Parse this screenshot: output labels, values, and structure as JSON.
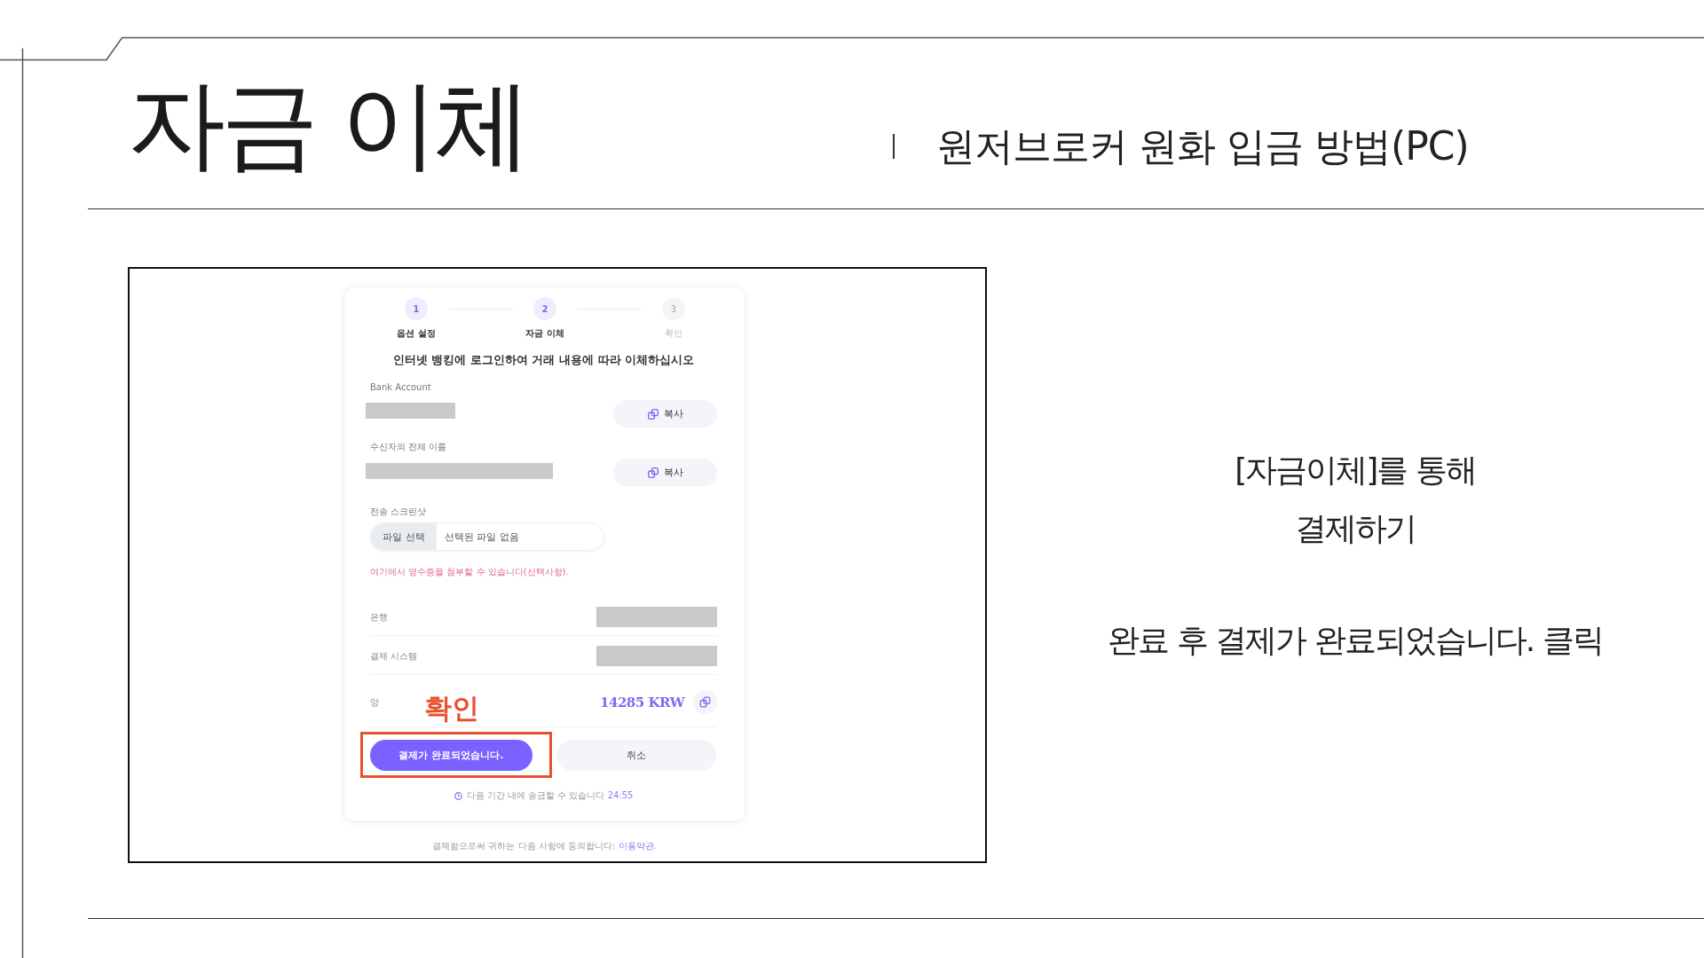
{
  "slide": {
    "title": "자금 이체",
    "subtitle": "원저브로커 원화 입금 방법(PC)"
  },
  "screenshot": {
    "steps": [
      {
        "number": "1",
        "label": "옵션 설정",
        "active": true
      },
      {
        "number": "2",
        "label": "자금 이체",
        "active": true
      },
      {
        "number": "3",
        "label": "확인",
        "active": false
      }
    ],
    "heading": "인터넷 뱅킹에 로그인하여 거래 내용에 따라 이체하십시오",
    "copy_fields": [
      {
        "label": "Bank Account",
        "button": "복사"
      },
      {
        "label": "수신자의 전체 이름",
        "button": "복사"
      }
    ],
    "upload": {
      "label": "전송 스크린샷",
      "button": "파일 선택",
      "value": "선택된 파일 없음",
      "note": "여기에서 영수증을 첨부할 수 있습니다(선택사항)."
    },
    "details": [
      {
        "kind": "redacted",
        "label": "은행"
      },
      {
        "kind": "redacted",
        "label": "결제 시스템"
      },
      {
        "kind": "amount",
        "label": "양",
        "value": "14285 KRW"
      }
    ],
    "annotation": {
      "text": "확인"
    },
    "buttons": [
      {
        "kind": "primary",
        "label": "결제가 완료되었습니다.",
        "highlighted": true
      },
      {
        "kind": "secondary",
        "label": "취소",
        "highlighted": false
      }
    ],
    "timer": {
      "text": "다음 기간 내에 송금할 수 있습니다",
      "time": "24:55"
    },
    "footer": {
      "text": "결제함으로써 귀하는 다음 사항에 동의합니다:",
      "link": "이용약관",
      "after": "."
    }
  },
  "notes": {
    "lines": [
      "[자금이체]를 통해",
      "결제하기"
    ],
    "instruction": "완료 후 결제가 완료되었습니다. 클릭"
  }
}
